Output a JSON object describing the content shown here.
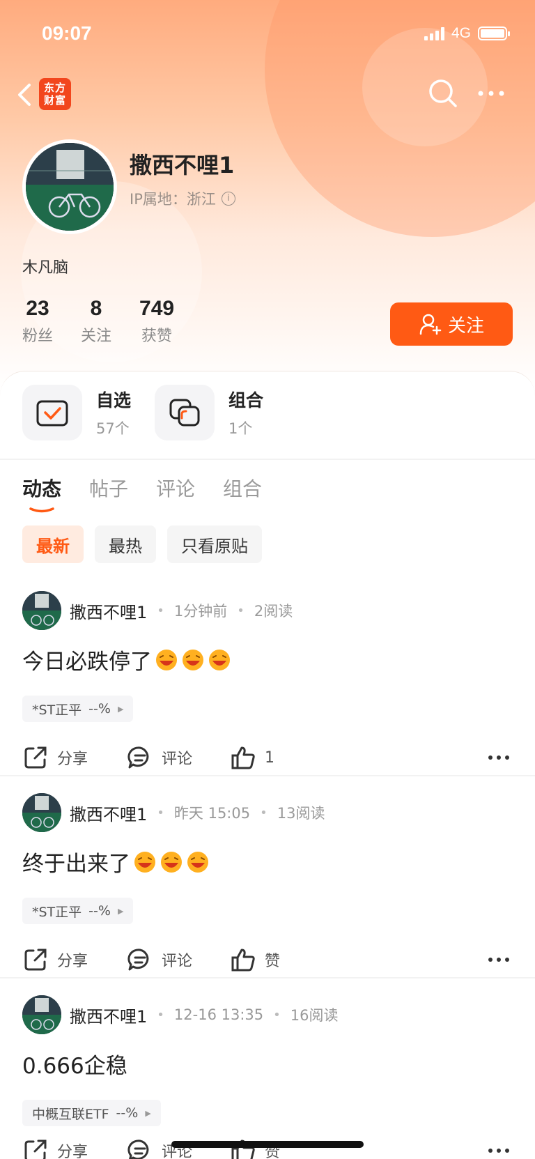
{
  "status_bar": {
    "time": "09:07",
    "network": "4G"
  },
  "nav": {
    "logo_text": "东方财富",
    "logo_line1": "东方",
    "logo_line2": "财富"
  },
  "profile": {
    "username": "撒西不哩1",
    "ip_label": "IP属地：浙江",
    "bio": "木凡脑",
    "stats": [
      {
        "num": "23",
        "label": "粉丝"
      },
      {
        "num": "8",
        "label": "关注"
      },
      {
        "num": "749",
        "label": "获赞"
      }
    ],
    "follow_label": "关注"
  },
  "quick_links": [
    {
      "title": "自选",
      "count": "57个"
    },
    {
      "title": "组合",
      "count": "1个"
    }
  ],
  "tabs": [
    "动态",
    "帖子",
    "评论",
    "组合"
  ],
  "filters": [
    "最新",
    "最热",
    "只看原贴"
  ],
  "posts": [
    {
      "user": "撒西不哩1",
      "time": "1分钟前",
      "reads": "2阅读",
      "text": "今日必跌停了",
      "emoji_count": 3,
      "tag_name": "*ST正平",
      "tag_change": "--%",
      "share": "分享",
      "comment": "评论",
      "like": "1"
    },
    {
      "user": "撒西不哩1",
      "time": "昨天 15:05",
      "reads": "13阅读",
      "text": "终于出来了",
      "emoji_count": 3,
      "tag_name": "*ST正平",
      "tag_change": "--%",
      "share": "分享",
      "comment": "评论",
      "like": "赞"
    },
    {
      "user": "撒西不哩1",
      "time": "12-16 13:35",
      "reads": "16阅读",
      "text": "0.666企稳",
      "emoji_count": 0,
      "tag_name": "中概互联ETF",
      "tag_change": "--%",
      "share": "分享",
      "comment": "评论",
      "like": "赞"
    }
  ],
  "colors": {
    "accent": "#ff5a14",
    "logo": "#f2461d"
  },
  "icons": [
    "back-icon",
    "search-icon",
    "more-icon",
    "info-icon",
    "add-user-icon",
    "watchlist-icon",
    "portfolio-icon",
    "share-icon",
    "comment-icon",
    "like-icon",
    "laugh-emoji-icon"
  ]
}
